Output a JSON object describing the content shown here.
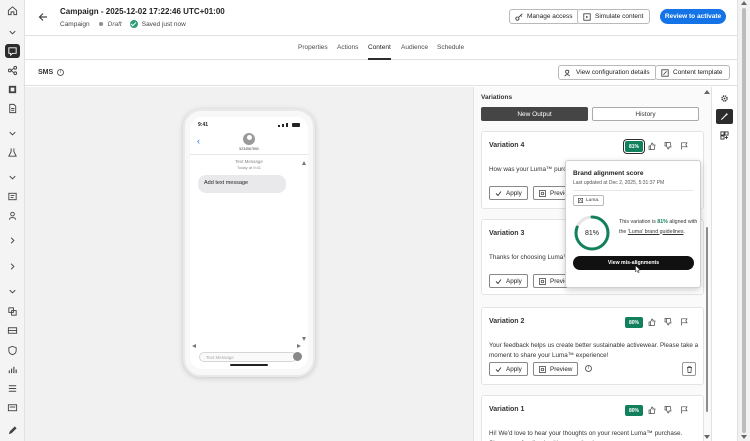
{
  "campaign": {
    "title": "Campaign - 2025-12-02 17:22:46 UTC+01:00",
    "type": "Campaign",
    "status": "Draft",
    "save_status": "Saved just now"
  },
  "header": {
    "manage_access": "Manage access",
    "simulate_content": "Simulate content",
    "review_to_activate": "Review to activate"
  },
  "tabs": [
    "Properties",
    "Actions",
    "Content",
    "Audience",
    "Schedule"
  ],
  "active_tab": "Content",
  "channel": {
    "label": "SMS",
    "view_config": "View configuration details",
    "content_template": "Content template"
  },
  "phone": {
    "time": "9:41",
    "number": "5234567890",
    "message_type": "Text Message",
    "message_time": "Today at 9:41",
    "bubble_text": "Add text message",
    "input_placeholder": "Text Message"
  },
  "variations_panel": {
    "title": "Variations",
    "tab_new_output": "New Output",
    "tab_history": "History",
    "apply_label": "Apply",
    "preview_label": "Preview",
    "items": [
      {
        "name": "Variation 4",
        "score": "81%",
        "text": "How was your Luma™ purchase? Share more detailed feedback"
      },
      {
        "name": "Variation 3",
        "score": "",
        "text": "Thanks for choosing Luma™! Exclusive rewards. Share your"
      },
      {
        "name": "Variation 2",
        "score": "80%",
        "text": "Your feedback helps us create better sustainable activewear. Please take a moment to share your Luma™ experience!"
      },
      {
        "name": "Variation 1",
        "score": "80%",
        "text": "Hi! We'd love to hear your thoughts on your recent Luma™ purchase. Share your feedback with us anytime!"
      }
    ]
  },
  "popover": {
    "title": "Brand alignment score",
    "updated": "Last updated at Dec 2, 2025, 5:31:37 PM",
    "brand": "Luma.",
    "score_value": 81,
    "score_label": "81%",
    "text_prefix": "This variation is ",
    "text_pct": "81%",
    "text_mid": " aligned with the ",
    "text_link": "'Luma' brand guidelines",
    "text_suffix": ".",
    "button": "View mis-alignments"
  },
  "colors": {
    "accent_blue": "#1473e6",
    "score_green": "#12805c",
    "dark": "#2c2c2c"
  }
}
